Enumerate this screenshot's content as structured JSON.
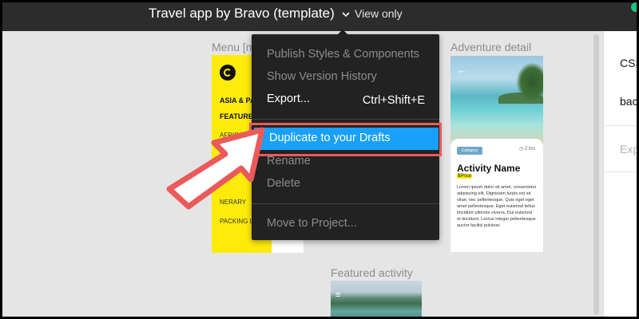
{
  "topbar": {
    "file_title": "Travel app by Bravo (template)",
    "view_mode": "View only"
  },
  "canvas": {
    "frames": [
      {
        "label": "Menu [m"
      },
      {
        "label": "Adventure detail"
      },
      {
        "label": "Featured activity"
      }
    ],
    "menu_frame_lines": [
      "ASIA & PACIF",
      "FEATURED TR",
      "AFRICA",
      "",
      "NERARY",
      "PACKING LIS"
    ],
    "adventure": {
      "category": "Category",
      "duration": "◷ 2 hrs",
      "title": "Activity Name",
      "price": "$Price",
      "body": "Lorem ipsum dolor sit amet, consectetur adipiscing elit. Dignissim turpis est sit vitae, nec pellentesque. Quis eget eget amet pellentesque. Eget euismod tellus tincidunt ultricies viverra. Dui euismod et tincidunt. Lectus integer pellentesque auctor facilisi pulvinar."
    }
  },
  "right_panel": {
    "items": [
      "CSS",
      "bac",
      "Exp"
    ]
  },
  "dropdown": {
    "items": [
      {
        "label": "Publish Styles & Components",
        "enabled": false
      },
      {
        "label": "Show Version History",
        "enabled": false
      },
      {
        "label": "Export...",
        "enabled": true,
        "shortcut": "Ctrl+Shift+E"
      },
      {
        "label": "Duplicate to your Drafts",
        "enabled": true,
        "highlighted": true
      },
      {
        "label": "Rename",
        "enabled": false
      },
      {
        "label": "Delete",
        "enabled": false
      },
      {
        "label": "Move to Project...",
        "enabled": false
      }
    ]
  },
  "annotation": {
    "arrow_color": "#ea5a5a",
    "highlight_color": "#18a0fb"
  }
}
